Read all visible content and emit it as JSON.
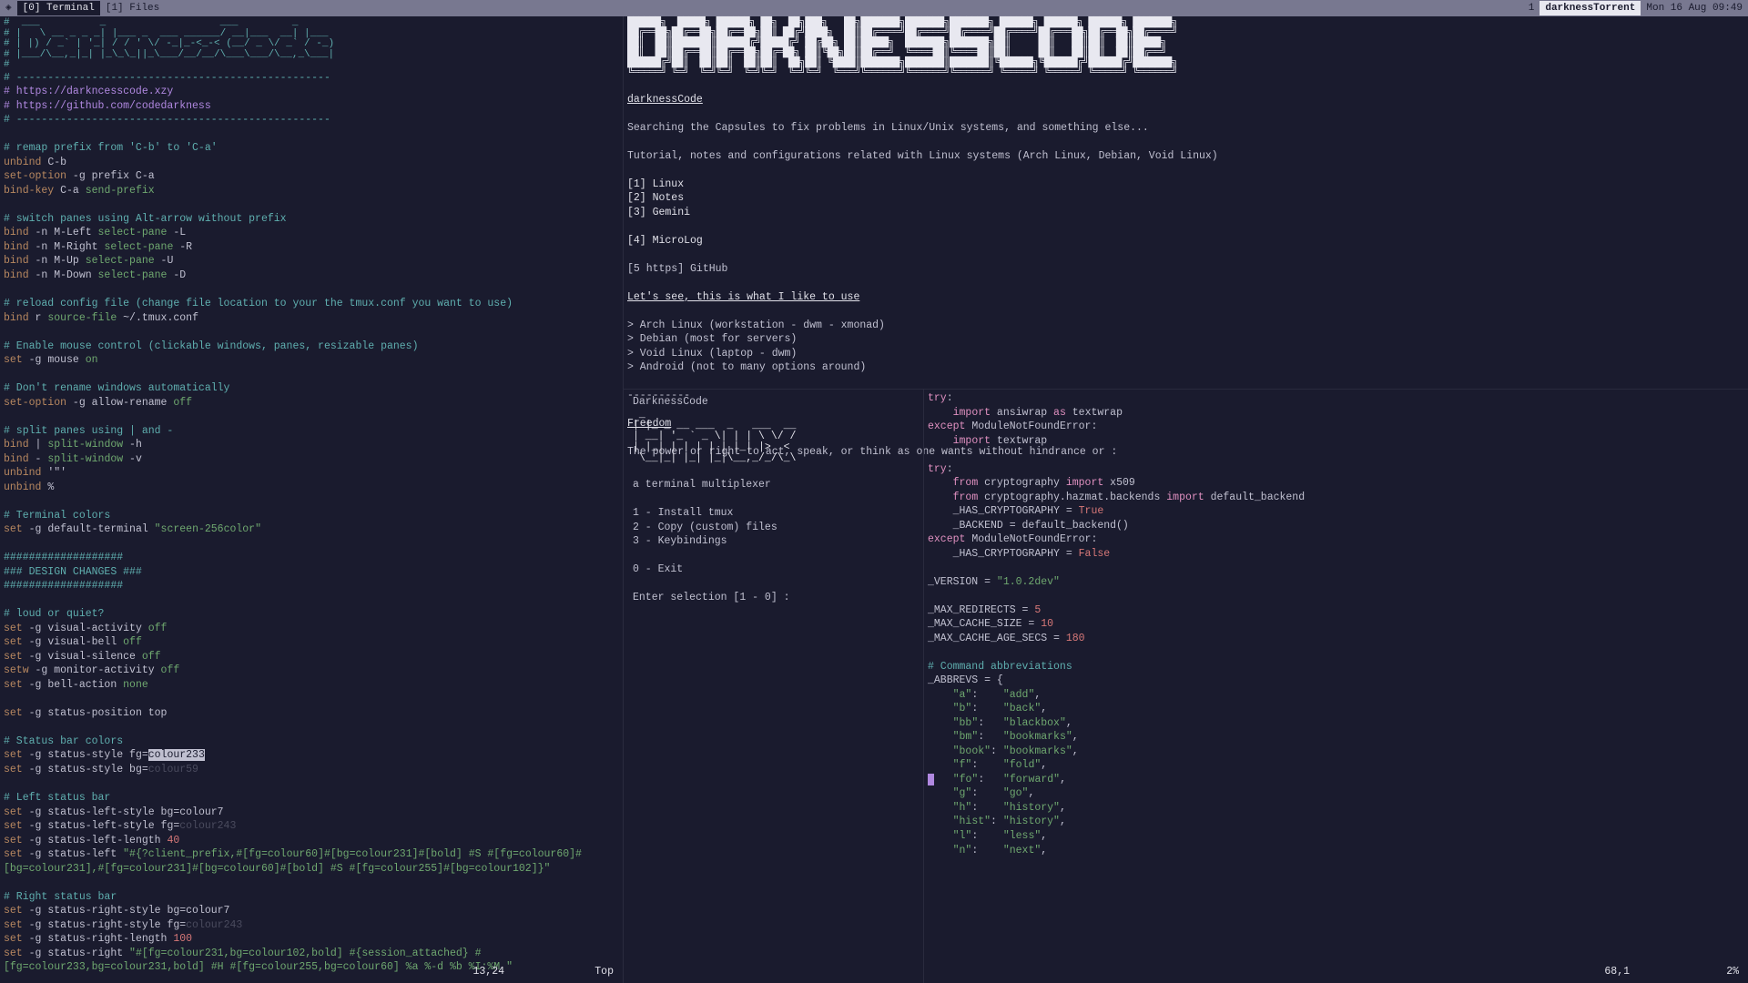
{
  "topbar": {
    "icon": "◈",
    "tab0": "[0] Terminal",
    "tab1": "[1] Files",
    "session_num": "1",
    "session_name": "darknessTorrent",
    "datetime": "Mon 16 Aug 09:49"
  },
  "left": {
    "ascii_header": "#  ___          _                   ___         _\n# |   \\ __ _ _ _| |___ _  ___ ______/ __|___  __| |___\n# | |) / _` | '_| / / ' \\/ -_|_-<_-< (__/ _ \\/ _` / -_)\n# |___/\\__,_|_| |_\\_\\_||_\\___/__/__/\\___\\___/\\__,_\\___|\n#",
    "sep": "# --------------------------------------------------",
    "url1": "# https://darkncesscode.xzy",
    "url2": "# https://github.com/codedarkness",
    "c_remap": "# remap prefix from 'C-b' to 'C-a'",
    "l_unbind_cb": "unbind",
    "v_cb": " C-b",
    "l_setopt": "set-option",
    "v_prefix": " -g prefix C-a",
    "l_bindkey": "bind-key",
    "v_sendprefix": " C-a ",
    "v_sendprefix2": "send-prefix",
    "c_switch": "# switch panes using Alt-arrow without prefix",
    "l_bind": "bind",
    "v_mleft": " -n M-Left ",
    "v_selpane": "select-pane",
    "v_L": " -L",
    "v_mright": " -n M-Right ",
    "v_R": " -R",
    "v_mup": " -n M-Up ",
    "v_U": " -U",
    "v_mdown": " -n M-Down ",
    "v_D": " -D",
    "c_reload": "# reload config file (change file location to your the tmux.conf you want to use)",
    "v_r": " r ",
    "v_sourcefile": "source-file",
    "v_conf": " ~/.tmux.conf",
    "c_mouse": "# Enable mouse control (clickable windows, panes, resizable panes)",
    "l_set": "set",
    "v_gmouse": " -g mouse ",
    "v_on": "on",
    "c_rename": "# Don't rename windows automatically",
    "v_allowrename": " -g allow-rename ",
    "v_off": "off",
    "c_split": "# split panes using | and -",
    "v_pipe": " | ",
    "v_splitwindow": "split-window",
    "v_h": " -h",
    "v_dash": " - ",
    "v_v": " -v",
    "v_unbind_q": " '\"'",
    "v_unbind_pct": " %",
    "c_termcolor": "# Terminal colors",
    "v_defterm": " -g default-terminal ",
    "v_screen256": "\"screen-256color\"",
    "design_sep": "###################",
    "design_title": "### DESIGN CHANGES ###",
    "c_loud": "# loud or quiet?",
    "v_visact": " -g visual-activity ",
    "v_visbell": " -g visual-bell ",
    "v_vissilence": " -g visual-silence ",
    "l_setw": "setw",
    "v_monact": " -g monitor-activity ",
    "v_bellact": " -g bell-action ",
    "v_none": "none",
    "v_statuspos": " -g status-position top",
    "c_statusbar": "# Status bar colors",
    "v_statusstyle_fg": " -g status-style fg=",
    "v_colour233": "colour233",
    "v_statusstyle_bg": " -g status-style bg=",
    "v_colour59": "colour59",
    "c_leftstatus": "# Left status bar",
    "v_sls_bg": " -g status-left-style bg=colour7",
    "v_sls_fg": " -g status-left-style fg=",
    "v_colour243": "colour243",
    "v_sll": " -g status-left-length ",
    "v_40": "40",
    "v_sl": " -g status-left ",
    "v_sl_str": "\"#{?client_prefix,#[fg=colour60]#[bg=colour231]#[bold] #S #[fg=colour60]#[bg=colour231],#[fg=colour231]#[bg=colour60]#[bold] #S #[fg=colour255]#[bg=colour102]}\"",
    "c_rightstatus": "# Right status bar",
    "v_srs_bg": " -g status-right-style bg=colour7",
    "v_srs_fg": " -g status-right-style fg=",
    "v_srl": " -g status-right-length ",
    "v_100": "100",
    "v_sr": " -g status-right ",
    "v_sr_str": "\"#[fg=colour231,bg=colour102,bold] #{session_attached} #[fg=colour233,bg=colour231,bold] #H #[fg=colour255,bg=colour60] %a %-d %b %I:%M \"",
    "vim_pos": "13,24",
    "vim_scroll": "Top"
  },
  "gemini": {
    "big_title": "██████╗  █████╗ ██████╗ ██╗  ██╗███╗   ██╗███████╗███████╗███████╗ ██████╗ ██████╗ ██████╗ ███████╗\n██╔══██╗██╔══██╗██╔══██╗██║ ██╔╝████╗  ██║██╔════╝██╔════╝██╔════╝██╔════╝██╔═══██╗██╔══██╗██╔════╝\n██║  ██║███████║██████╔╝█████╔╝ ██╔██╗ ██║█████╗  ███████╗███████╗██║     ██║   ██║██║  ██║█████╗  \n██║  ██║██╔══██║██╔══██╗██╔═██╗ ██║╚██╗██║██╔══╝  ╚════██║╚════██║██║     ██║   ██║██║  ██║██╔══╝  \n██████╔╝██║  ██║██║  ██║██║  ██╗██║ ╚████║███████╗███████║███████║╚██████╗╚██████╔╝██████╔╝███████╗\n╚═════╝ ╚═╝  ╚═╝╚═╝  ╚═╝╚═╝  ╚═╝╚═╝  ╚═══╝╚══════╝╚══════╝╚══════╝ ╚═════╝ ╚═════╝ ╚═════╝ ╚══════╝",
    "h1": "darknessCode",
    "p1": "Searching the Capsules to fix problems in Linux/Unix systems, and something else...",
    "p2": "Tutorial, notes and configurations related with Linux systems (Arch Linux, Debian, Void Linux)",
    "li1": "[1] Linux",
    "li2": "[2] Notes",
    "li3": "[3] Gemini",
    "li4": "[4] MicroLog",
    "li5": "[5 https] GitHub",
    "h2": "Let's see, this is what I like to use",
    "b1": "> Arch Linux (workstation - dwm - xmonad)",
    "b2": "> Debian (most for servers)",
    "b3": "> Void Linux (laptop - dwm)",
    "b4": "> Android (not to many options around)",
    "rule": "----------",
    "h3": "Freedom",
    "p3": "The power or right to act, speak, or think as one wants without hindrance or :"
  },
  "bl": {
    "title": "DarknessCode",
    "ascii": " _\n| |_ _ __ ___  _   ___  __\n| __| '_ ` _ \\| | | \\ \\/ /\n| |_| | | | | | |_| |>  <\n \\__|_| |_| |_|\\__,_/_/\\_\\",
    "sub": "a terminal multiplexer",
    "m1": "1 - Install tmux",
    "m2": "2 - Copy (custom) files",
    "m3": "3 - Keybindings",
    "m0": "0 - Exit",
    "prompt": "Enter selection [1 - 0] :"
  },
  "br": {
    "vim_pos": "68,1",
    "vim_scroll": "2%"
  }
}
